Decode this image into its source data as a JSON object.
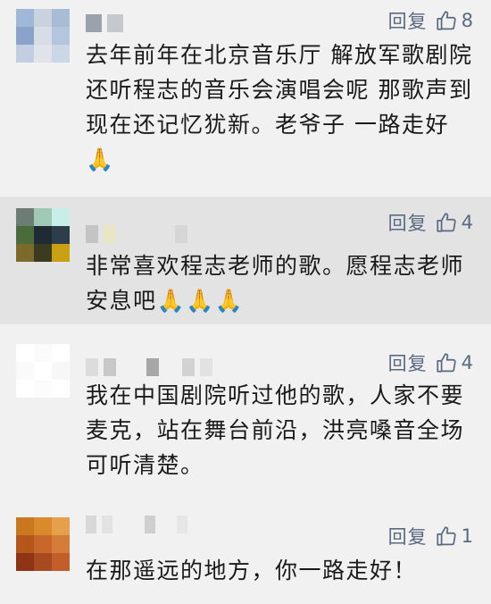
{
  "comments": [
    {
      "text": "去年前年在北京音乐厅 解放军歌剧院 还听程志的音乐会演唱会呢 那歌声到现在还记忆犹新。老爷子 一路走好",
      "emoji": "🙏",
      "reply_label": "回复",
      "likes": "8"
    },
    {
      "text": "非常喜欢程志老师的歌。愿程志老师安息吧",
      "emoji": "🙏🙏🙏",
      "reply_label": "回复",
      "likes": "4"
    },
    {
      "text": "我在中国剧院听过他的歌，人家不要麦克，站在舞台前沿，洪亮嗓音全场可听清楚。",
      "emoji": "",
      "reply_label": "回复",
      "likes": "4"
    },
    {
      "text": "在那遥远的地方，你一路走好！",
      "emoji": "",
      "reply_label": "回复",
      "likes": "1"
    }
  ],
  "icons": {
    "like": "thumbs-up-icon"
  },
  "colors": {
    "action": "#5a6a82",
    "text": "#1a1a1a",
    "highlight_bg": "#e3e3e3",
    "bg": "#f1f1f1"
  }
}
